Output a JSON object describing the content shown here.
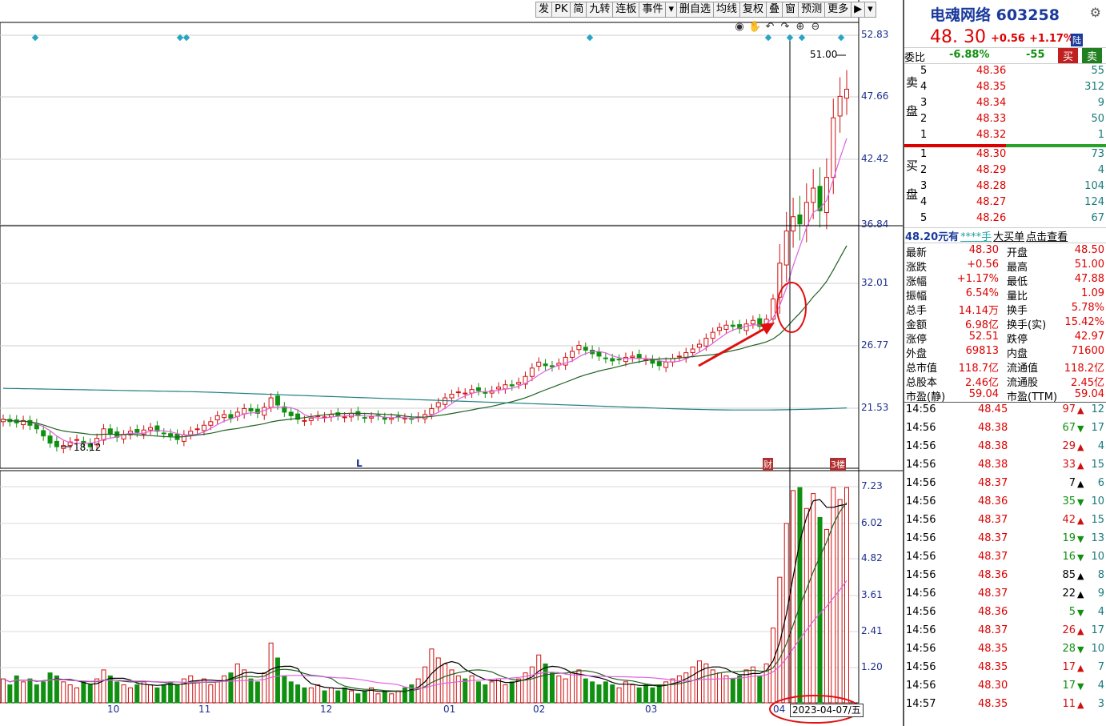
{
  "toolbar": {
    "items": [
      "发",
      "PK",
      "简",
      "九转",
      "连板",
      "事件",
      "▾",
      "删自选",
      "均线",
      "复权",
      "叠",
      "窗",
      "预测",
      "更多",
      "▶",
      "▾"
    ]
  },
  "chart_icons": [
    "eye-icon",
    "hand-icon",
    "undo-icon",
    "redo-icon",
    "zoom-in-icon",
    "zoom-out-icon"
  ],
  "chart_icon_glyphs": [
    "◉",
    "✋",
    "↶",
    "↷",
    "⊕",
    "⊖"
  ],
  "price_axis": [
    "52.83",
    "47.66",
    "42.42",
    "36.84",
    "32.01",
    "26.77",
    "21.53"
  ],
  "volume_axis": [
    "7.23",
    "6.02",
    "4.82",
    "3.61",
    "2.41",
    "1.20"
  ],
  "x_axis": [
    "10",
    "11",
    "12",
    "01",
    "02",
    "03",
    "04"
  ],
  "cursor_date": "2023-04-07/五",
  "annotations": {
    "high": "51.00",
    "low": "18.12",
    "l_marker": "L",
    "fin_marker": "财",
    "badge": "3楼"
  },
  "colors": {
    "up": "#d01010",
    "down": "#109010",
    "ma_short": "#e060e0",
    "ma_mid": "#206020",
    "ma_long": "#208080",
    "axis_text": "#1c2f8e"
  },
  "quote": {
    "name": "电魂网络 603258",
    "price": "48. 30",
    "change": "+0.56",
    "change_pct": "+1.17%",
    "lu_badge": "陆",
    "weibi_label": "委比",
    "weibi_pct": "-6.88%",
    "weibi_diff": "-55",
    "sell_btn": "买",
    "buy_btn": "卖"
  },
  "sell_side_label": [
    "卖",
    "盘"
  ],
  "buy_side_label": [
    "买",
    "盘"
  ],
  "sell_orders": [
    {
      "n": "5",
      "p": "48.36",
      "q": "55"
    },
    {
      "n": "4",
      "p": "48.35",
      "q": "312"
    },
    {
      "n": "3",
      "p": "48.34",
      "q": "9"
    },
    {
      "n": "2",
      "p": "48.33",
      "q": "50"
    },
    {
      "n": "1",
      "p": "48.32",
      "q": "1"
    }
  ],
  "buy_orders": [
    {
      "n": "1",
      "p": "48.30",
      "q": "73"
    },
    {
      "n": "2",
      "p": "48.29",
      "q": "4"
    },
    {
      "n": "3",
      "p": "48.28",
      "q": "104"
    },
    {
      "n": "4",
      "p": "48.27",
      "q": "124"
    },
    {
      "n": "5",
      "p": "48.26",
      "q": "67"
    }
  ],
  "big_order_bar": [
    "48.20元有",
    "****手",
    "大买单",
    "点击查看"
  ],
  "stats": [
    {
      "la": "最新",
      "va": "48.30",
      "lb": "开盘",
      "vb": "48.50"
    },
    {
      "la": "涨跌",
      "va": "+0.56",
      "lb": "最高",
      "vb": "51.00"
    },
    {
      "la": "涨幅",
      "va": "+1.17%",
      "lb": "最低",
      "vb": "47.88"
    },
    {
      "la": "振幅",
      "va": "6.54%",
      "lb": "量比",
      "vb": "1.09"
    },
    {
      "la": "总手",
      "va": "14.14万",
      "lb": "换手",
      "vb": "5.78%"
    },
    {
      "la": "金额",
      "va": "6.98亿",
      "lb": "换手(实)",
      "vb": "15.42%"
    },
    {
      "la": "涨停",
      "va": "52.51",
      "lb": "跌停",
      "vb": "42.97"
    },
    {
      "la": "外盘",
      "va": "69813",
      "lb": "内盘",
      "vb": "71600"
    },
    {
      "la": "总市值",
      "va": "118.7亿",
      "lb": "流通值",
      "vb": "118.2亿"
    },
    {
      "la": "总股本",
      "va": "2.46亿",
      "lb": "流通股",
      "vb": "2.45亿"
    },
    {
      "la": "市盈(静)",
      "va": "59.04",
      "lb": "市盈(TTM)",
      "vb": "59.04"
    }
  ],
  "ticks": [
    {
      "t": "14:56",
      "p": "48.45",
      "v": "97",
      "d": "up",
      "n": "12"
    },
    {
      "t": "14:56",
      "p": "48.38",
      "v": "67",
      "d": "down",
      "n": "17"
    },
    {
      "t": "14:56",
      "p": "48.38",
      "v": "29",
      "d": "up",
      "n": "4"
    },
    {
      "t": "14:56",
      "p": "48.38",
      "v": "33",
      "d": "up",
      "n": "15"
    },
    {
      "t": "14:56",
      "p": "48.37",
      "v": "7",
      "d": "upblack",
      "n": "6"
    },
    {
      "t": "14:56",
      "p": "48.36",
      "v": "35",
      "d": "down",
      "n": "10"
    },
    {
      "t": "14:56",
      "p": "48.37",
      "v": "42",
      "d": "up",
      "n": "15"
    },
    {
      "t": "14:56",
      "p": "48.37",
      "v": "19",
      "d": "down",
      "n": "13"
    },
    {
      "t": "14:56",
      "p": "48.37",
      "v": "16",
      "d": "down",
      "n": "10"
    },
    {
      "t": "14:56",
      "p": "48.36",
      "v": "85",
      "d": "upblack",
      "n": "8"
    },
    {
      "t": "14:56",
      "p": "48.37",
      "v": "22",
      "d": "upblack",
      "n": "9"
    },
    {
      "t": "14:56",
      "p": "48.36",
      "v": "5",
      "d": "down",
      "n": "4"
    },
    {
      "t": "14:56",
      "p": "48.37",
      "v": "26",
      "d": "up",
      "n": "17"
    },
    {
      "t": "14:56",
      "p": "48.35",
      "v": "28",
      "d": "down",
      "n": "10"
    },
    {
      "t": "14:56",
      "p": "48.35",
      "v": "17",
      "d": "up",
      "n": "7"
    },
    {
      "t": "14:56",
      "p": "48.30",
      "v": "17",
      "d": "down",
      "n": "4"
    },
    {
      "t": "14:57",
      "p": "48.35",
      "v": "11",
      "d": "up",
      "n": "3"
    }
  ],
  "chart_data": {
    "type": "candlestick",
    "price_range": [
      16.5,
      55.0
    ],
    "volume_range": [
      0,
      7.23
    ],
    "closes": [
      20.6,
      20.4,
      20.3,
      20.5,
      20.1,
      19.8,
      19.2,
      18.6,
      18.3,
      18.4,
      18.7,
      18.9,
      18.6,
      18.3,
      19.0,
      19.8,
      19.4,
      19.1,
      19.3,
      19.6,
      19.5,
      19.7,
      19.9,
      19.6,
      19.4,
      19.2,
      18.9,
      19.3,
      19.6,
      19.8,
      20.1,
      20.4,
      20.9,
      21.0,
      20.7,
      21.2,
      21.5,
      21.3,
      21.1,
      21.6,
      22.4,
      21.8,
      21.2,
      20.9,
      20.6,
      20.5,
      20.7,
      20.9,
      20.8,
      21.0,
      20.9,
      20.8,
      21.1,
      20.9,
      20.7,
      20.8,
      20.9,
      20.6,
      20.7,
      20.8,
      20.7,
      20.6,
      20.8,
      21.0,
      21.5,
      22.0,
      22.4,
      22.7,
      22.9,
      22.8,
      23.1,
      23.0,
      22.8,
      23.0,
      23.3,
      23.5,
      23.4,
      23.7,
      24.2,
      24.9,
      25.4,
      25.1,
      25.0,
      25.3,
      25.8,
      26.3,
      26.8,
      26.4,
      26.1,
      25.9,
      25.7,
      25.5,
      25.6,
      25.8,
      25.9,
      25.7,
      25.6,
      25.3,
      25.1,
      25.4,
      25.7,
      25.9,
      26.2,
      26.5,
      26.9,
      27.4,
      27.9,
      28.3,
      28.5,
      28.4,
      28.2,
      28.6,
      28.9,
      28.4,
      29.0,
      30.7,
      33.7,
      36.4,
      37.6,
      37.0,
      38.8,
      40.0,
      38.1,
      40.9,
      45.9,
      47.7,
      48.3
    ],
    "volumes": [
      0.8,
      0.6,
      0.9,
      0.7,
      0.8,
      0.6,
      0.7,
      1.0,
      0.9,
      0.7,
      0.6,
      0.5,
      0.7,
      0.6,
      0.8,
      1.1,
      0.9,
      0.7,
      0.6,
      0.5,
      0.6,
      0.7,
      0.6,
      0.5,
      0.6,
      0.7,
      0.6,
      0.8,
      0.9,
      0.7,
      0.8,
      0.6,
      0.7,
      0.9,
      1.0,
      1.3,
      1.1,
      0.8,
      0.7,
      1.0,
      2.0,
      1.5,
      0.9,
      0.7,
      0.6,
      0.5,
      0.5,
      0.6,
      0.4,
      0.5,
      0.4,
      0.5,
      0.4,
      0.3,
      0.4,
      0.5,
      0.3,
      0.4,
      0.3,
      0.4,
      0.5,
      0.6,
      0.8,
      1.2,
      1.8,
      1.5,
      1.3,
      1.1,
      0.9,
      0.8,
      0.9,
      0.7,
      0.6,
      0.7,
      0.8,
      0.6,
      0.7,
      0.8,
      1.0,
      1.2,
      1.6,
      1.3,
      1.0,
      0.9,
      0.8,
      1.0,
      1.1,
      0.8,
      0.7,
      0.6,
      0.7,
      0.6,
      0.5,
      0.7,
      0.6,
      0.5,
      0.6,
      0.5,
      0.6,
      0.7,
      0.8,
      0.9,
      1.0,
      1.2,
      1.4,
      1.3,
      1.1,
      1.0,
      0.9,
      0.8,
      0.9,
      1.1,
      1.2,
      0.9,
      1.3,
      2.5,
      4.2,
      6.0,
      7.1,
      7.2,
      6.5,
      7.0,
      6.2,
      5.8,
      7.2,
      6.8,
      7.2
    ],
    "ma5_vol_note": "",
    "ylabels_price": [
      "52.83",
      "47.66",
      "42.42",
      "36.84",
      "32.01",
      "26.77",
      "21.53"
    ],
    "ylabels_volume": [
      "7.23",
      "6.02",
      "4.82",
      "3.61",
      "2.41",
      "1.20"
    ]
  }
}
